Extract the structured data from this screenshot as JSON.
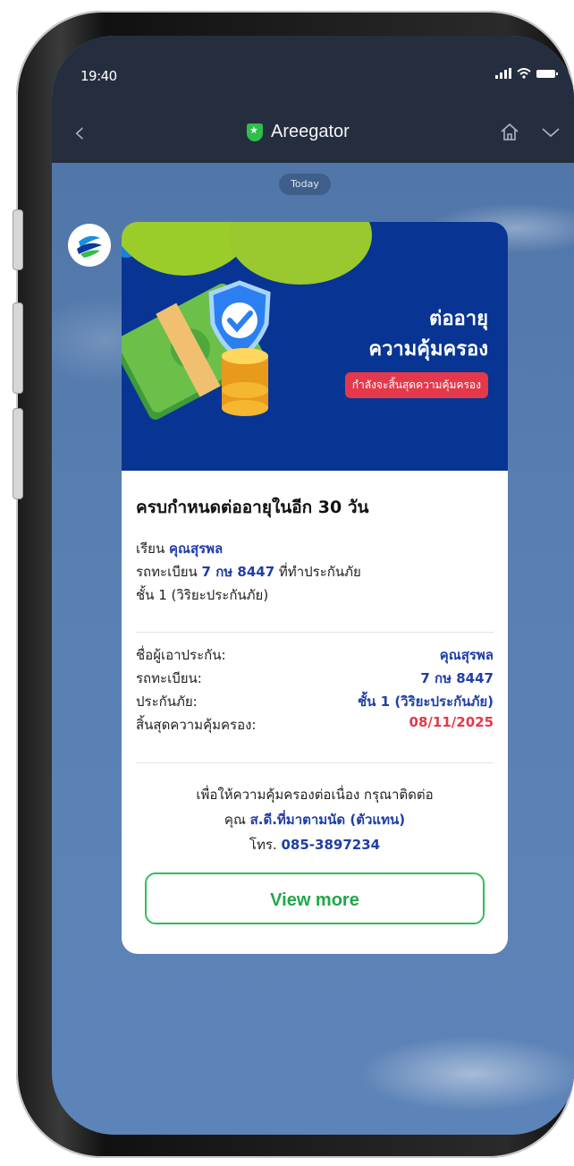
{
  "status": {
    "time": "19:40"
  },
  "nav": {
    "title": "Areegator"
  },
  "chat": {
    "date_chip": "Today"
  },
  "banner": {
    "line1": "ต่ออายุ",
    "line2": "ความคุ้มครอง",
    "tag": "กำลังจะสิ้นสุดความคุ้มครอง"
  },
  "card": {
    "heading": "ครบกำหนดต่ออายุในอีก 30 วัน",
    "intro": {
      "salutation": "เรียน ",
      "name": "คุณสุรพล",
      "plate_prefix": "รถทะเบียน ",
      "plate": "7 กษ 8447",
      "plate_suffix": " ที่ทำประกันภัย",
      "class_line": "ชั้น 1 (วิริยะประกันภัย)"
    },
    "details": [
      {
        "key": "ชื่อผู้เอาประกัน:",
        "value": "คุณสุรพล"
      },
      {
        "key": "รถทะเบียน:",
        "value": "7 กษ 8447"
      },
      {
        "key": "ประกันภัย:",
        "value": "ชั้น 1 (วิริยะประกันภัย)"
      },
      {
        "key": "สิ้นสุดความคุ้มครอง:",
        "value": "08/11/2025"
      }
    ],
    "contact": {
      "line1": "เพื่อให้ความคุ้มครองต่อเนื่อง กรุณาติดต่อ",
      "line2_prefix": "คุณ ",
      "agent": "ส.ดี.ที่มาตามนัด (ตัวแทน)",
      "line3_prefix": "โทร. ",
      "phone": "085-3897234"
    },
    "button_label": "View more"
  },
  "colors": {
    "accent_blue": "#1f3ea8",
    "alert_red": "#e5384a",
    "line_green": "#2fbf5a",
    "banner_navy": "#083593"
  }
}
